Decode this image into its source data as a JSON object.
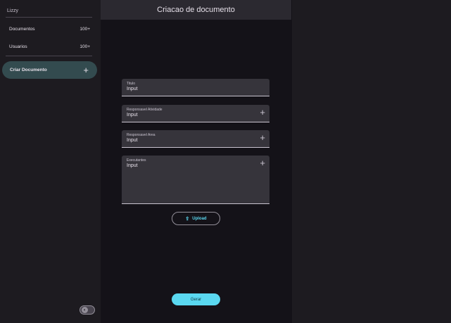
{
  "sidebar": {
    "brand": "Lizzy",
    "items": [
      {
        "label": "Documentos",
        "count": "100+"
      },
      {
        "label": "Usuarios",
        "count": "100+"
      }
    ],
    "create_label": "Criar Documento",
    "create_icon": "plus-icon",
    "theme_toggle_icon": "theme-toggle-icon"
  },
  "header": {
    "title": "Criacao de documento"
  },
  "form": {
    "fields": [
      {
        "label": "Titulo",
        "value": "Input"
      },
      {
        "label": "Responsavel Atividade",
        "value": "Input"
      },
      {
        "label": "Responsavel Area",
        "value": "Input"
      },
      {
        "label": "Executantes",
        "value": "Input"
      }
    ],
    "plus_glyph": "+",
    "upload_label": "Upload",
    "submit_label": "Gerar"
  },
  "colors": {
    "accent": "#5ad8f0",
    "active_nav": "#334b4f",
    "background": "#141218",
    "surface": "#1d1b20"
  }
}
